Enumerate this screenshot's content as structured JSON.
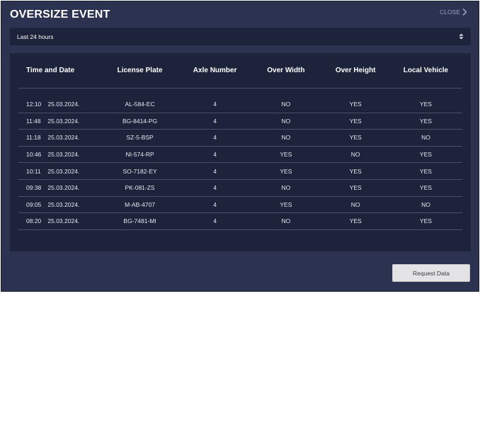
{
  "header": {
    "title": "OVERSIZE EVENT",
    "close_label": "CLOSE"
  },
  "filter": {
    "selected": "Last 24 hours"
  },
  "table": {
    "columns": [
      "Time and Date",
      "License Plate",
      "Axle Number",
      "Over Width",
      "Over Height",
      "Local Vehicle"
    ],
    "rows": [
      {
        "time": "12:10",
        "date": "25.03.2024.",
        "plate": "AL-584-EC",
        "axles": "4",
        "over_width": "NO",
        "over_height": "YES",
        "local": "YES"
      },
      {
        "time": "11:48",
        "date": "25.03.2024.",
        "plate": "BG-8414-PG",
        "axles": "4",
        "over_width": "NO",
        "over_height": "YES",
        "local": "YES"
      },
      {
        "time": "11:18",
        "date": "25.03.2024.",
        "plate": "SZ-5-BSP",
        "axles": "4",
        "over_width": "NO",
        "over_height": "YES",
        "local": "NO"
      },
      {
        "time": "10:46",
        "date": "25.03.2024.",
        "plate": "NI-574-RP",
        "axles": "4",
        "over_width": "YES",
        "over_height": "NO",
        "local": "YES"
      },
      {
        "time": "10:11",
        "date": "25.03.2024.",
        "plate": "SO-7182-EY",
        "axles": "4",
        "over_width": "YES",
        "over_height": "YES",
        "local": "YES"
      },
      {
        "time": "09:38",
        "date": "25.03.2024.",
        "plate": "PK-081-ZS",
        "axles": "4",
        "over_width": "NO",
        "over_height": "YES",
        "local": "YES"
      },
      {
        "time": "09:05",
        "date": "25.03.2024.",
        "plate": "M-AB-4707",
        "axles": "4",
        "over_width": "YES",
        "over_height": "NO",
        "local": "NO"
      },
      {
        "time": "08:20",
        "date": "25.03.2024.",
        "plate": "BG-7481-MI",
        "axles": "4",
        "over_width": "NO",
        "over_height": "YES",
        "local": "YES"
      }
    ]
  },
  "actions": {
    "request_label": "Request Data"
  },
  "icons": {
    "close": "chevron-right-icon",
    "select": "sort-arrows-icon"
  },
  "colors": {
    "window_bg": "#2b3350",
    "panel_bg": "#1d233a",
    "divider": "#495069",
    "button_bg": "#e4e4e6"
  }
}
